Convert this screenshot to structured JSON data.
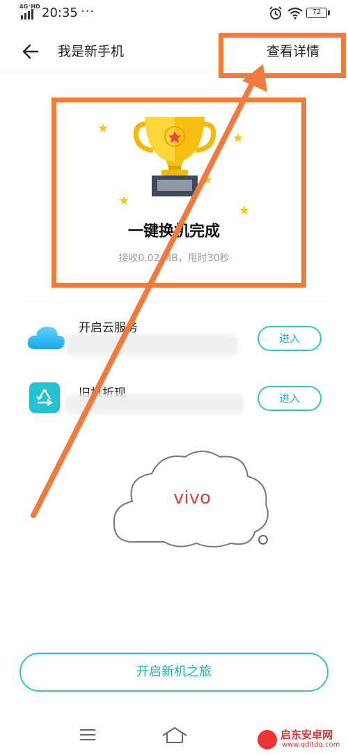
{
  "status_bar": {
    "network": "4G⁺HD",
    "time": "20:35",
    "more": "···",
    "battery": "72"
  },
  "header": {
    "title": "我是新手机",
    "detail_link": "查看详情"
  },
  "result": {
    "title": "一键换机完成",
    "subtitle": "接收0.02 MB，用时30秒"
  },
  "items": [
    {
      "title": "开启云服务",
      "desc_visible": "...",
      "button": "进入",
      "icon": "cloud-icon"
    },
    {
      "title": "旧机折现",
      "button": "进入",
      "icon": "recycle-icon"
    }
  ],
  "watermark": {
    "cloud_text": "vivo",
    "site_name": "启东安卓网",
    "site_url": "www.qdltdq.com"
  },
  "start_button": "开启新机之旅",
  "colors": {
    "accent": "#2ec6cb",
    "annotation": "#f47a3c",
    "trophy": "#f5b800"
  }
}
